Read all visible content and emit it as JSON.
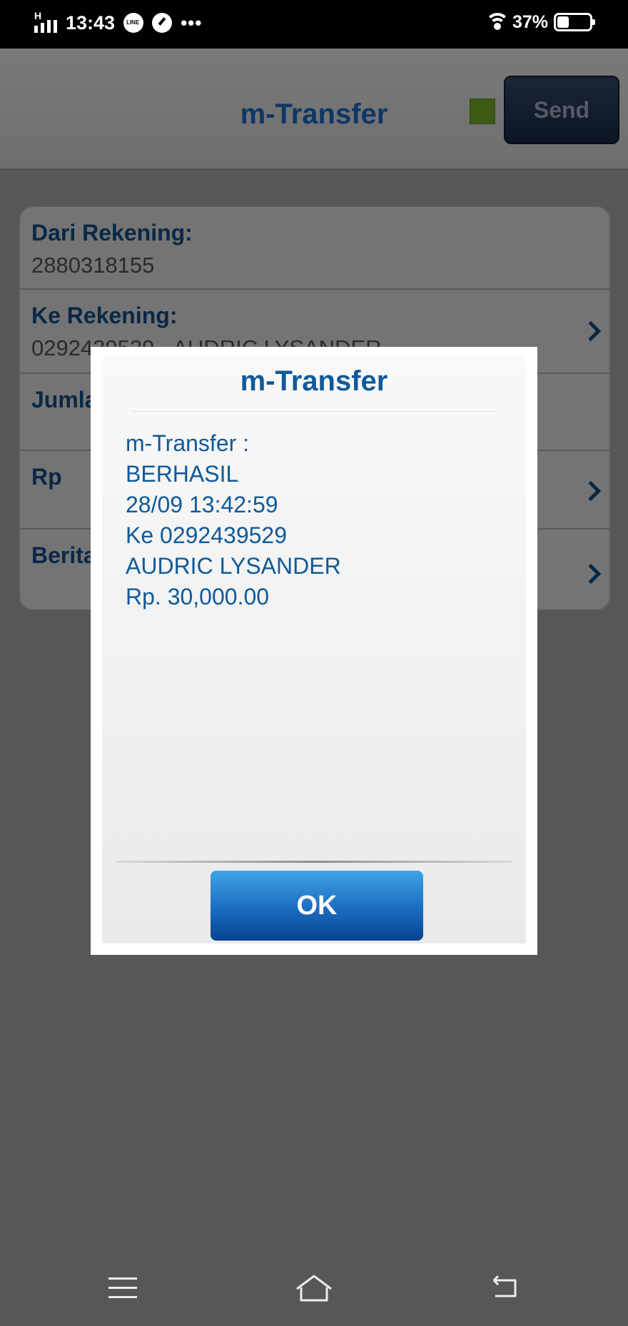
{
  "status_bar": {
    "network_label": "H",
    "time": "13:43",
    "line_label": "LINE",
    "more": "•••",
    "battery_percent": "37%",
    "battery_level": 0.37
  },
  "header": {
    "title": "m-Transfer",
    "send_label": "Send",
    "indicator_color": "#3c5a13"
  },
  "form": {
    "rows": [
      {
        "label": "Dari Rekening:",
        "value": "2880318155"
      },
      {
        "label": "Ke Rekening:",
        "value": "0292439529 - AUDRIC LYSANDER"
      },
      {
        "label": "Jumla",
        "value": ""
      },
      {
        "label": "Rp",
        "value": ""
      },
      {
        "label": "Berita",
        "value": ""
      }
    ]
  },
  "dialog": {
    "title": "m-Transfer",
    "message_lines": [
      "m-Transfer :",
      "BERHASIL",
      "28/09 13:42:59",
      "Ke 0292439529",
      "AUDRIC LYSANDER",
      "Rp. 30,000.00"
    ],
    "ok_label": "OK",
    "accent_color": "#0e5a9a"
  },
  "nav": {
    "icons": [
      "menu-icon",
      "home-icon",
      "back-icon"
    ]
  }
}
